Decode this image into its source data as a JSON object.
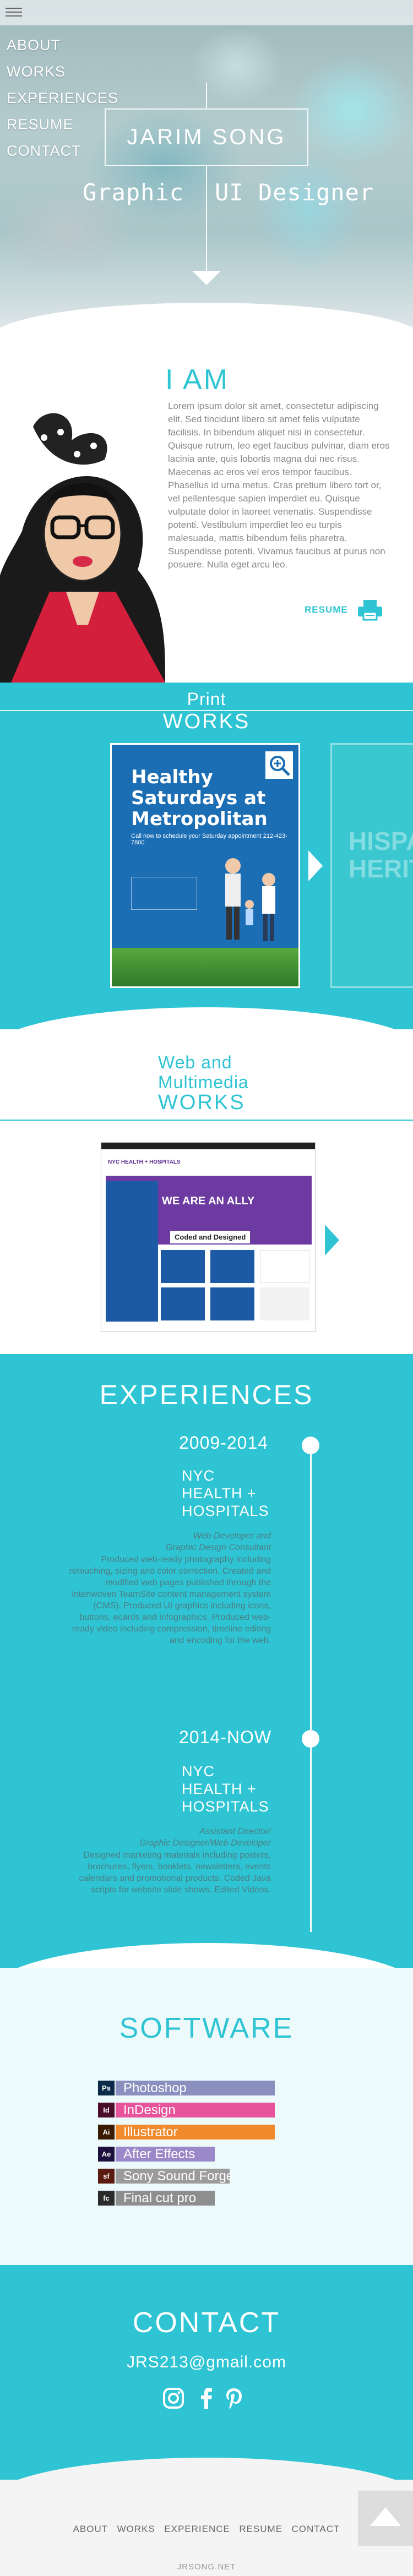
{
  "nav": {
    "items": [
      "ABOUT",
      "WORKS",
      "EXPERIENCES",
      "RESUME",
      "CONTACT"
    ]
  },
  "hero": {
    "name": "JARIM SONG",
    "tagline_left": "Graphic",
    "tagline_right": "UI Designer"
  },
  "about": {
    "title": "I AM",
    "bio": "Lorem ipsum dolor sit amet, consectetur adipiscing elit. Sed tincidunt libero sit amet felis vulputate facilisis. In bibendum aliquet nisi in consectetur. Quisque rutrum, leo eget faucibus pulvinar, diam eros lacinia ante, quis lobortis magna dui nec risus. Maecenas ac eros vel eros tempor faucibus. Phasellus id urna metus. Cras pretium libero tort or, vel pellentesque sapien imperdiet eu. Quisque vulputate dolor in laoreet venenatis. Suspendisse potenti. Vestibulum imperdiet leo eu turpis malesuada, mattis bibendum felis pharetra. Suspendisse potenti. Vivamus faucibus at purus non posuere. Nulla eget arcu leo.",
    "resume_label": "RESUME"
  },
  "print_works": {
    "subtitle": "Print",
    "title": "WORKS",
    "card_heading": "Healthy Saturdays at Metropolitan",
    "card_subtext": "Call now to schedule your Saturday appointment 212-423-7800",
    "card2_heading": "HISPA HERIT"
  },
  "web_works": {
    "subtitle_line1": "Web and",
    "subtitle_line2": "Multimedia",
    "title": "WORKS",
    "shot_logo": "NYC HEALTH + HOSPITALS",
    "shot_headline": "WE ARE AN ALLY",
    "shot_badge": "Coded and Designed"
  },
  "experiences": {
    "title": "EXPERIENCES",
    "items": [
      {
        "years": "2009-2014",
        "org_line1": "NYC",
        "org_line2": "HEALTH +",
        "org_line3": "HOSPITALS",
        "role_line1": "Web Developer and",
        "role_line2": "Graphic Design Consultant",
        "description": "Produced web-ready photography including retouching, sizing and color correction. Created and modified web pages published through the intenwoven TeamSite content management system (CMS). Produced UI graphics including icons, buttons, ecards and infographics. Produced web-ready video including compression, timeline editing and encoding for the web."
      },
      {
        "years": "2014-NOW",
        "org_line1": "NYC",
        "org_line2": "HEALTH +",
        "org_line3": "HOSPITALS",
        "role_line1": "Assistant Director/",
        "role_line2": "Graphic Designer/Web Developer",
        "description": "Designed marketing materials including posters, brochures, flyers, booklets, newsletters, events calendars and promotional products. Coded Java scripts for website slide shows. Edited Videos."
      }
    ]
  },
  "software": {
    "title": "SOFTWARE",
    "skills": [
      {
        "name": "Photoshop",
        "icon": "Ps",
        "icon_color": "#0b2a4a",
        "bar_color": "#8b8fbf",
        "level": 0.85
      },
      {
        "name": "InDesign",
        "icon": "Id",
        "icon_color": "#4a0d2a",
        "bar_color": "#e8549b",
        "level": 0.85
      },
      {
        "name": "Illustrator",
        "icon": "Ai",
        "icon_color": "#3a1a00",
        "bar_color": "#f08a2c",
        "level": 0.85
      },
      {
        "name": "After Effects",
        "icon": "Ae",
        "icon_color": "#1d0f3e",
        "bar_color": "#9a88c8",
        "level": 0.53
      },
      {
        "name": "Sony Sound Forge",
        "icon": "sf",
        "icon_color": "#5a1a10",
        "bar_color": "#9b9b9b",
        "level": 0.61
      },
      {
        "name": "Final cut pro",
        "icon": "fc",
        "icon_color": "#2b2b2b",
        "bar_color": "#8e8e8e",
        "level": 0.53
      }
    ]
  },
  "contact": {
    "title": "CONTACT",
    "email": "JRS213@gmail.com"
  },
  "footer": {
    "nav": [
      "ABOUT",
      "WORKS",
      "EXPERIENCE",
      "RESUME",
      "CONTACT"
    ],
    "site": "JRSONG.NET"
  },
  "colors": {
    "accent": "#2ec4d3",
    "text_muted": "#8a8a8a",
    "exp_text": "#4c7f85"
  }
}
